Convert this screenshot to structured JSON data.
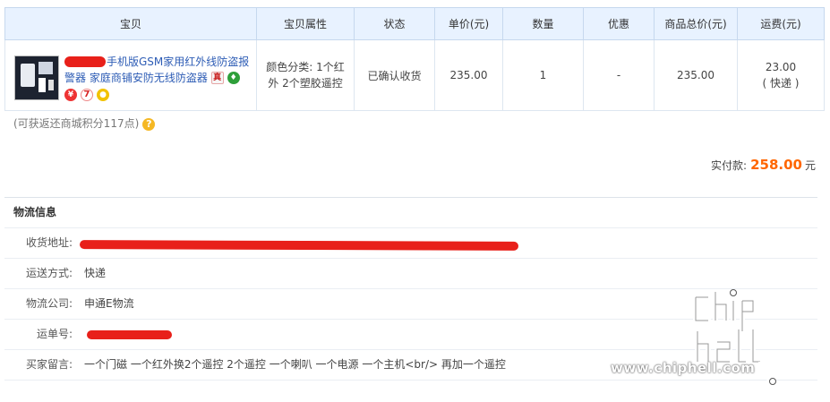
{
  "table": {
    "headers": [
      "宝贝",
      "宝贝属性",
      "状态",
      "单价(元)",
      "数量",
      "优惠",
      "商品总价(元)",
      "运费(元)"
    ],
    "row": {
      "product_title": "手机版GSM家用红外线防盗报警器 家庭商铺安防无线防盗器",
      "badge_zhen": "真",
      "badge_seven": "7",
      "attributes": "颜色分类: 1个红外 2个塑胶遥控",
      "status": "已确认收货",
      "unit_price": "235.00",
      "quantity": "1",
      "discount": "-",
      "total_price": "235.00",
      "shipping_fee": "23.00",
      "shipping_method": "( 快递 )"
    }
  },
  "points": {
    "text": "(可获返还商城积分117点)",
    "help_symbol": "?"
  },
  "payment": {
    "label": "实付款:",
    "amount": "258.00",
    "unit": "元"
  },
  "logistics": {
    "title": "物流信息",
    "address_label": "收货地址:",
    "delivery_method_label": "运送方式:",
    "delivery_method": "快递",
    "company_label": "物流公司:",
    "company": "申通E物流",
    "tracking_label": "运单号:",
    "message_label": "买家留言:",
    "message": "一个门磁 一个红外换2个遥控 2个遥控 一个喇叭 一个电源 一个主机<br/> 再加一个遥控"
  },
  "watermark": {
    "logo": "chip hell",
    "url": "www.chiphell.com"
  },
  "colors": {
    "accent_orange": "#ff6600",
    "link_blue": "#2d5cb5",
    "header_bg": "#e8f2ff",
    "redaction_red": "#e8201a"
  }
}
